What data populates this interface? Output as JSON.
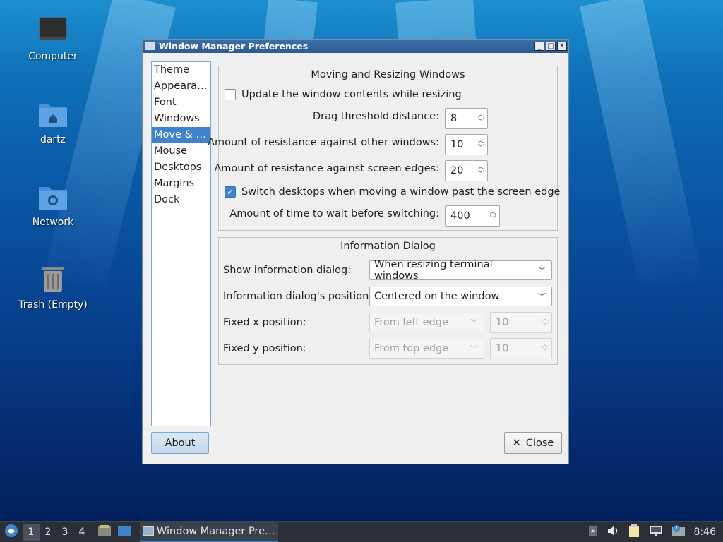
{
  "desktop": {
    "icons": [
      {
        "label": "Computer",
        "icon": "computer-icon"
      },
      {
        "label": "dartz",
        "icon": "home-folder-icon"
      },
      {
        "label": "Network",
        "icon": "network-folder-icon"
      },
      {
        "label": "Trash (Empty)",
        "icon": "trash-icon"
      }
    ]
  },
  "window": {
    "title": "Window Manager Preferences",
    "sidebar": {
      "items": [
        "Theme",
        "Appeara…",
        "Font",
        "Windows",
        "Move & …",
        "Mouse",
        "Desktops",
        "Margins",
        "Dock"
      ],
      "selected": "Move & …"
    },
    "moving": {
      "title": "Moving and Resizing Windows",
      "update_contents_label": "Update the window contents while resizing",
      "update_contents_checked": false,
      "drag_threshold_label": "Drag threshold distance:",
      "drag_threshold_value": "8",
      "resist_windows_label": "Amount of resistance against other windows:",
      "resist_windows_value": "10",
      "resist_edges_label": "Amount of resistance against screen edges:",
      "resist_edges_value": "20",
      "switch_desktops_label": "Switch desktops when moving a window past the screen edge",
      "switch_desktops_checked": true,
      "wait_time_label": "Amount of time to wait before switching:",
      "wait_time_value": "400"
    },
    "info": {
      "title": "Information Dialog",
      "show_label": "Show information dialog:",
      "show_value": "When resizing terminal windows",
      "position_label": "Information dialog's position:",
      "position_value": "Centered on the window",
      "fixed_x_label": "Fixed x position:",
      "fixed_x_combo": "From left edge",
      "fixed_x_value": "10",
      "fixed_y_label": "Fixed y position:",
      "fixed_y_combo": "From top edge",
      "fixed_y_value": "10"
    },
    "about_label": "About",
    "close_label": "Close"
  },
  "taskbar": {
    "workspaces": [
      "1",
      "2",
      "3",
      "4"
    ],
    "active_workspace": "1",
    "task_label": "Window Manager Pre…",
    "clock": "8:46"
  },
  "colors": {
    "accent": "#3f83cc",
    "taskbar": "#2b3038",
    "titlebar": "#2d5b93"
  }
}
